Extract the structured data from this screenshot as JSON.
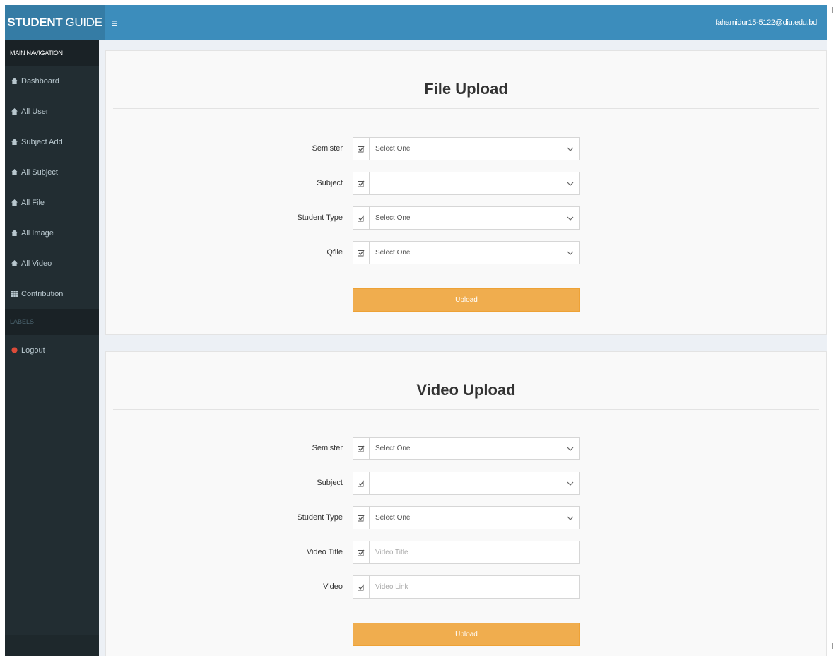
{
  "header": {
    "brand_bold": "STUDENT",
    "brand_rest": "GUIDE",
    "menu_icon": "hamburger-icon",
    "user_email": "fahamidur15-5122@diu.edu.bd"
  },
  "sidebar": {
    "header": "MAIN NAVIGATION",
    "items": [
      {
        "label": "Dashboard",
        "icon": "dashboard-icon"
      },
      {
        "label": "All User",
        "icon": "dashboard-icon"
      },
      {
        "label": "Subject Add",
        "icon": "dashboard-icon"
      },
      {
        "label": "All Subject",
        "icon": "dashboard-icon"
      },
      {
        "label": "All File",
        "icon": "dashboard-icon"
      },
      {
        "label": "All Image",
        "icon": "dashboard-icon"
      },
      {
        "label": "All Video",
        "icon": "dashboard-icon"
      },
      {
        "label": "Contribution",
        "icon": "grid-icon"
      }
    ],
    "labels_header": "LABELS",
    "logout": {
      "label": "Logout",
      "icon": "circle-icon",
      "icon_color": "#dd4b39"
    }
  },
  "file_upload": {
    "title": "File Upload",
    "fields": [
      {
        "label": "Semister",
        "value": "Select One",
        "type": "select"
      },
      {
        "label": "Subject",
        "value": "",
        "type": "select"
      },
      {
        "label": "Student Type",
        "value": "Select One",
        "type": "select"
      },
      {
        "label": "Qfile",
        "value": "Select One",
        "type": "select"
      }
    ],
    "button": "Upload"
  },
  "video_upload": {
    "title": "Video Upload",
    "fields": [
      {
        "label": "Semister",
        "value": "Select One",
        "type": "select"
      },
      {
        "label": "Subject",
        "value": "",
        "type": "select"
      },
      {
        "label": "Student Type",
        "value": "Select One",
        "type": "select"
      },
      {
        "label": "Video Title",
        "placeholder": "Video Title",
        "type": "input"
      },
      {
        "label": "Video",
        "placeholder": "Video Link",
        "type": "input"
      }
    ],
    "button": "Upload"
  },
  "colors": {
    "brand": "#357ca5",
    "topbar": "#3c8dbc",
    "sidebar": "#222d32",
    "button": "#f0ad4e"
  }
}
